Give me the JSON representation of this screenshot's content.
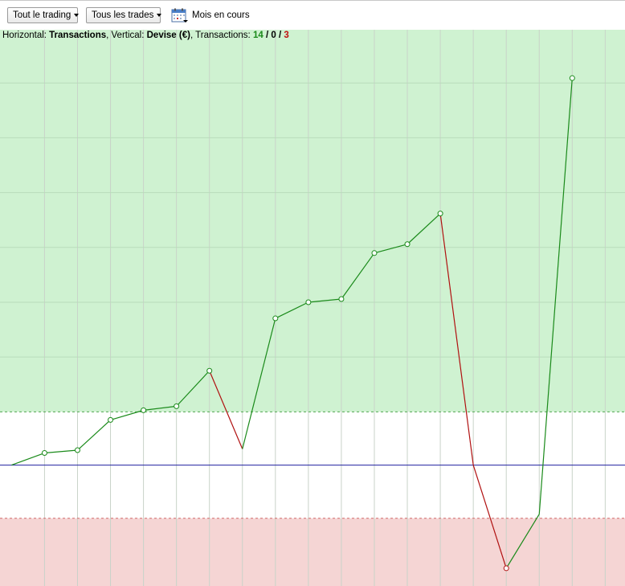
{
  "toolbar": {
    "filter_trading": "Tout le trading",
    "filter_trades": "Tous les trades",
    "period_label": "Mois en cours",
    "period_icon": "calendar-icon"
  },
  "info": {
    "h_prefix": "Horizontal: ",
    "h_value": "Transactions",
    "v_prefix": ", Vertical: ",
    "v_value": "Devise (€)",
    "t_prefix": ", Transactions: ",
    "wins": "14",
    "sep1": " / ",
    "even": "0",
    "sep2": " / ",
    "losses": "3"
  },
  "colors": {
    "profit_zone": "#cff2d1",
    "loss_zone": "#f5d5d4",
    "up_line": "#1a8a1a",
    "down_line": "#b01010",
    "zero_line": "#2020a0",
    "grid": "#c9d3c9"
  },
  "chart_data": {
    "type": "line",
    "x": [
      0,
      1,
      2,
      3,
      4,
      5,
      6,
      7,
      8,
      9,
      10,
      11,
      12,
      13,
      14,
      15,
      16,
      17
    ],
    "y": [
      0,
      15.0,
      18.5,
      56,
      68,
      73,
      117,
      20,
      182,
      202,
      206,
      263,
      274,
      312,
      0,
      -128,
      -61,
      480
    ],
    "markers": [
      false,
      true,
      true,
      true,
      true,
      true,
      true,
      false,
      true,
      true,
      true,
      true,
      true,
      true,
      false,
      true,
      false,
      true
    ],
    "ylim": [
      -150,
      540
    ],
    "xlim": [
      -0.35,
      18.6
    ],
    "profit_threshold": 66,
    "loss_threshold": -66,
    "xlabel": "Transactions",
    "ylabel": "Devise (€)"
  }
}
